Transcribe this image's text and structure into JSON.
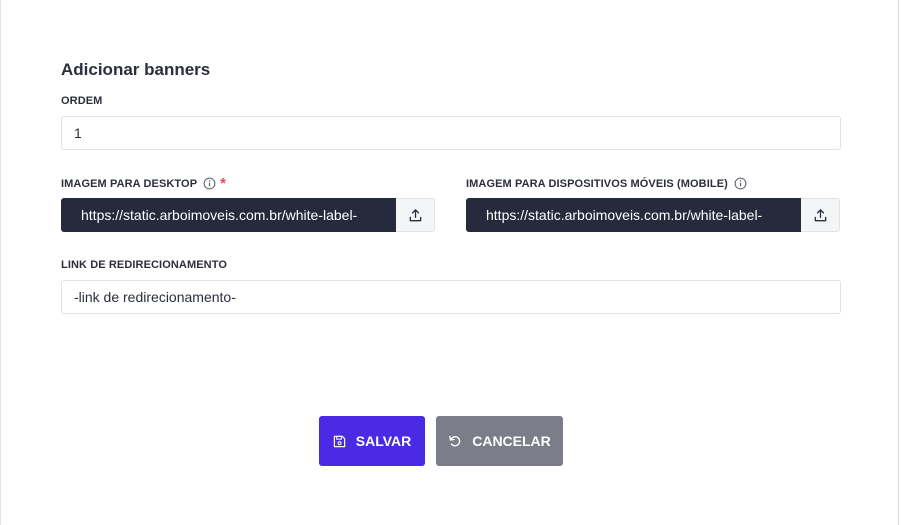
{
  "modal": {
    "title": "Adicionar banners"
  },
  "ordem": {
    "label": "ORDEM",
    "value": "1"
  },
  "desktop_image": {
    "label": "IMAGEM PARA DESKTOP",
    "required_mark": "*",
    "info_icon": "info-circle-icon",
    "url": "https://static.arboimoveis.com.br/white-label-",
    "upload_icon": "upload-icon"
  },
  "mobile_image": {
    "label": "IMAGEM PARA DISPOSITIVOS MÓVEIS (MOBILE)",
    "info_icon": "info-circle-icon",
    "url": "https://static.arboimoveis.com.br/white-label-",
    "upload_icon": "upload-icon"
  },
  "redirect_link": {
    "label": "LINK DE REDIRECIONAMENTO",
    "value": "-link de redirecionamento-"
  },
  "actions": {
    "save_label": "SALVAR",
    "save_icon": "floppy-disk-icon",
    "cancel_label": "CANCELAR",
    "cancel_icon": "undo-icon"
  },
  "colors": {
    "primary": "#4a2ae5",
    "secondary": "#7b7e88",
    "dark_field": "#252a3d",
    "required": "#e5484d"
  }
}
